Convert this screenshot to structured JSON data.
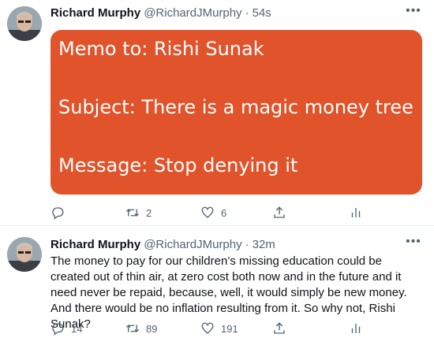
{
  "tweets": [
    {
      "author_name": "Richard Murphy",
      "handle": "@RichardJMurphy",
      "separator": "·",
      "time": "54s",
      "image_text": {
        "line1": "Memo to: Rishi Sunak",
        "line2": "Subject: There is a magic money tree",
        "line3": "Message: Stop denying it"
      },
      "image_bg_color": "#e0532b",
      "replies": "",
      "retweets": "2",
      "likes": "6"
    },
    {
      "author_name": "Richard Murphy",
      "handle": "@RichardJMurphy",
      "separator": "·",
      "time": "32m",
      "text": "The money to pay for our children’s missing education could be created out of thin air, at zero cost both now and in the future and it need never be repaid, because, well, it would simply be new money. And there would be no inflation resulting from it. So why not, Rishi Sunak?",
      "replies": "14",
      "retweets": "89",
      "likes": "191"
    }
  ],
  "icons": {
    "more": "more-icon",
    "reply": "reply-icon",
    "retweet": "retweet-icon",
    "like": "heart-icon",
    "share": "share-icon",
    "analytics": "analytics-icon"
  },
  "colors": {
    "text_primary": "#0f1419",
    "text_secondary": "#536471",
    "divider": "#e6ecf0"
  }
}
